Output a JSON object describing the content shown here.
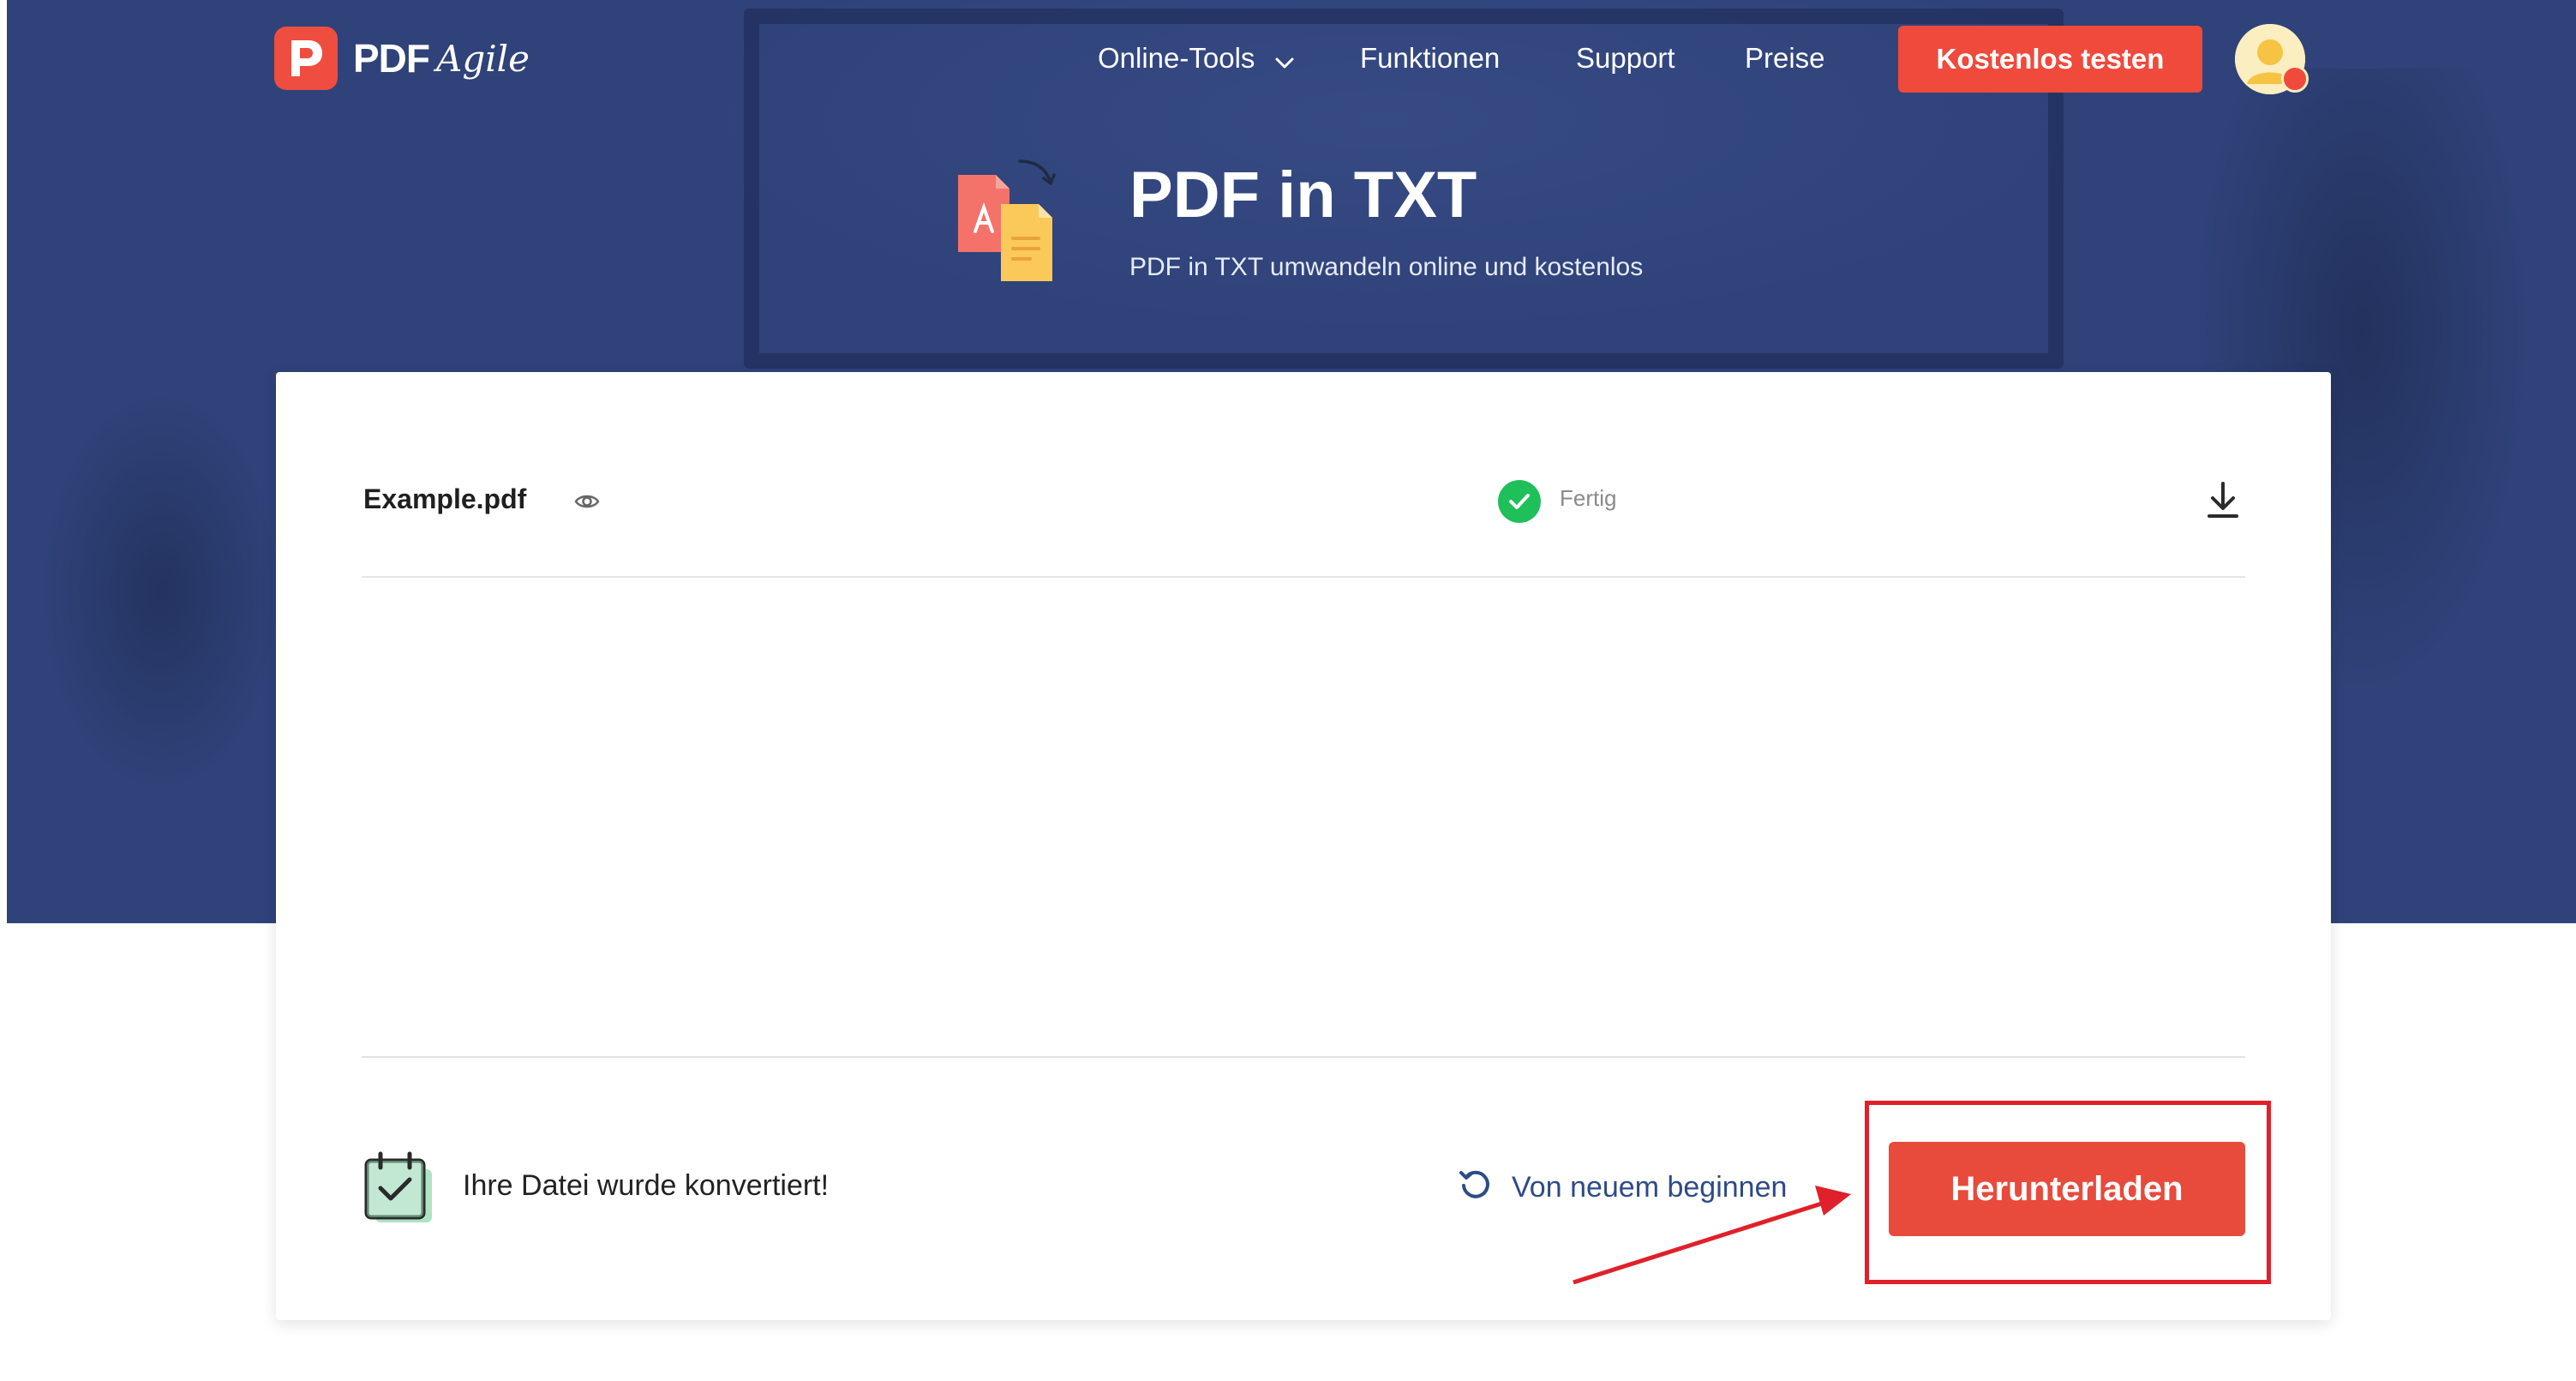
{
  "header": {
    "logo_text": "PDF",
    "logo_script": "Agile",
    "nav": [
      {
        "label": "Online-Tools",
        "has_dropdown": true
      },
      {
        "label": "Funktionen"
      },
      {
        "label": "Support"
      },
      {
        "label": "Preise"
      }
    ],
    "cta_label": "Kostenlos testen"
  },
  "hero": {
    "title": "PDF in TXT",
    "subtitle": "PDF in TXT umwandeln online und kostenlos"
  },
  "file": {
    "name": "Example.pdf",
    "status": "Fertig"
  },
  "footer": {
    "message": "Ihre Datei wurde konvertiert!",
    "restart_label": "Von neuem beginnen",
    "download_label": "Herunterladen"
  },
  "colors": {
    "hero_bg": "#2f4279",
    "brand_red": "#e84a3c",
    "success_green": "#1fbf5a",
    "link_blue": "#2e4a88",
    "annotation_red": "#e0202a"
  },
  "icons": {
    "logo": "pdfagile-logo-icon",
    "dropdown": "chevron-down-icon",
    "avatar": "user-avatar-icon",
    "tool": "pdf-to-txt-icon",
    "preview": "eye-icon",
    "status": "check-circle-icon",
    "download": "download-icon",
    "done": "calendar-check-icon",
    "restart": "refresh-icon"
  }
}
